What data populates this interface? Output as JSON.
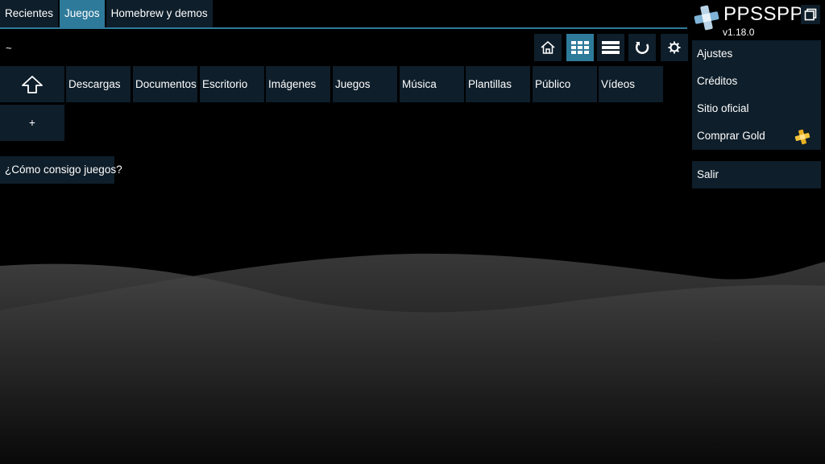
{
  "tabs": [
    {
      "label": "Recientes",
      "active": false
    },
    {
      "label": "Juegos",
      "active": true
    },
    {
      "label": "Homebrew y demos",
      "active": false
    }
  ],
  "path": "~",
  "toolbar": {
    "home_icon": "home-icon",
    "grid_icon": "grid-view-icon",
    "list_icon": "list-view-icon",
    "refresh_icon": "refresh-icon",
    "settings_icon": "gear-icon"
  },
  "folders": {
    "up_icon": "arrow-up-icon",
    "items": [
      "Descargas",
      "Documentos",
      "Escritorio",
      "Imágenes",
      "Juegos",
      "Música",
      "Plantillas",
      "Público",
      "Vídeos"
    ],
    "add_label": "+"
  },
  "help_button": "¿Cómo consigo juegos?",
  "brand": {
    "name": "PPSSPP",
    "version": "v1.18.0"
  },
  "menu": {
    "items": [
      "Ajustes",
      "Créditos",
      "Sitio oficial",
      "Comprar Gold"
    ],
    "quit": "Salir"
  },
  "colors": {
    "accent": "#2e7a9a",
    "tile": "#0e1e2a",
    "gold": "#e8b020"
  }
}
